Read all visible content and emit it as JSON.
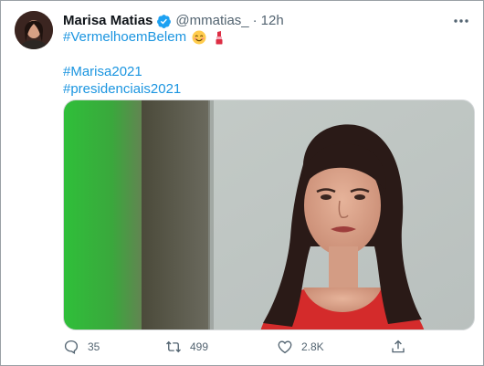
{
  "tweet": {
    "author_name": "Marisa Matias",
    "handle": "@mmatias_",
    "separator": "·",
    "time": "12h",
    "hashtag_line1": "#VermelhoemBelem",
    "hashtag_line3": "#Marisa2021",
    "hashtag_line4": "#presidenciais2021",
    "emoji_1": "smiling-face-emoji",
    "emoji_2": "lipstick-emoji"
  },
  "actions": {
    "reply_count": "35",
    "retweet_count": "499",
    "like_count": "2.8K"
  },
  "colors": {
    "hashtag": "#1b95e0",
    "verified": "#1da1f2",
    "muted": "#536471"
  }
}
